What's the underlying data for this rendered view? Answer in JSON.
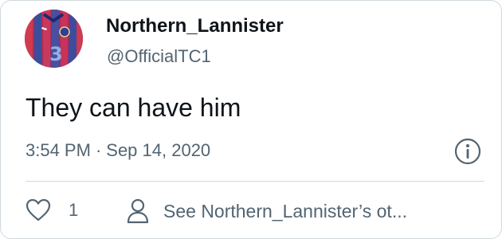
{
  "tweet": {
    "author": {
      "display_name": "Northern_Lannister",
      "handle": "@OfficialTC1",
      "avatar_icon": "chelsea-third-kit-jersey"
    },
    "text": "They can have him",
    "time": "3:54 PM",
    "separator": "·",
    "date": "Sep 14, 2020",
    "info_icon": "info-circle"
  },
  "actions": {
    "like_icon": "heart-outline",
    "like_count": "1",
    "profile_icon": "person-outline",
    "profile_link_text": "See Northern_Lannister’s ot..."
  },
  "colors": {
    "text_primary": "#0f1419",
    "text_secondary": "#536471",
    "border": "#cfd9de"
  }
}
